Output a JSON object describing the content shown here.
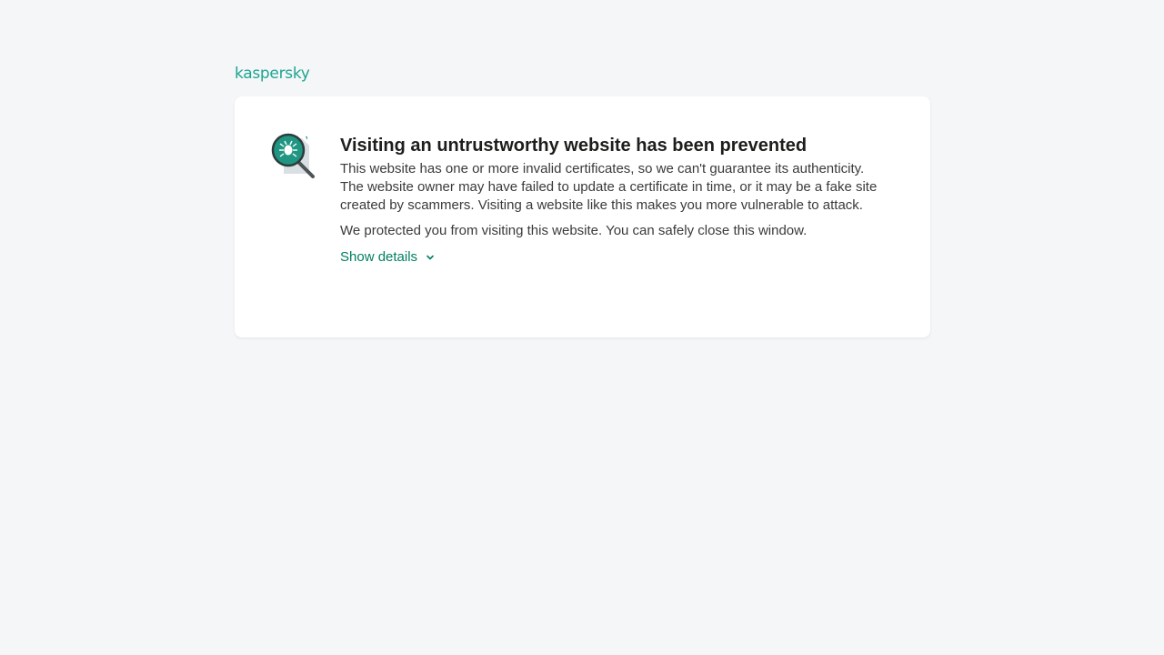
{
  "brand": {
    "logo_text": "kaspersky",
    "accent_color": "#1fa591"
  },
  "warning": {
    "title": "Visiting an untrustworthy website has been prevented",
    "description": "This website has one or more invalid certificates, so we can't guarantee its authenticity. The website owner may have failed to update a certificate in time, or it may be a fake site created by scammers. Visiting a website like this makes you more vulnerable to attack.",
    "protected_message": "We protected you from visiting this website. You can safely close this window.",
    "details_link": "Show details",
    "icon": "bug-magnifier-icon",
    "link_color": "#007f61"
  }
}
